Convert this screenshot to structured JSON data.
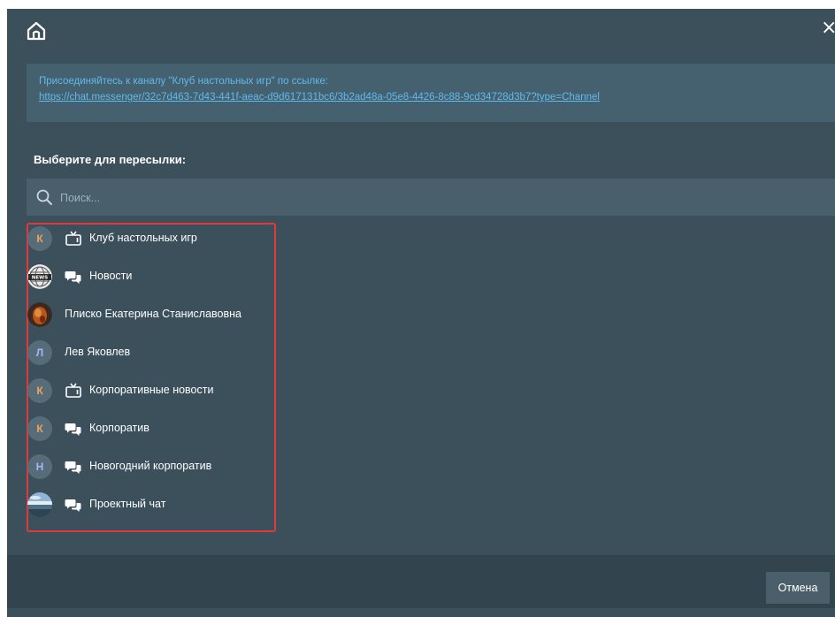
{
  "header": {
    "home_icon": "home-icon",
    "close_label": "×"
  },
  "message": {
    "text": "Присоединяйтесь к каналу \"Клуб настольных игр\" по ссылке:",
    "link": "https://chat.messenger/32c7d463-7d43-441f-aeac-d9d617131bc6/3b2ad48a-05e8-4426-8c88-9cd34728d3b7?type=Channel"
  },
  "forward": {
    "label": "Выберите для пересылки:"
  },
  "search": {
    "placeholder": "Поиск..."
  },
  "contacts": [
    {
      "name": "Клуб настольных игр",
      "avatar": "К",
      "avatar_style": "letter-orange",
      "type": "channel"
    },
    {
      "name": "Новости",
      "avatar": "news-globe",
      "avatar_style": "image",
      "type": "group"
    },
    {
      "name": "Плиско Екатерина Станиславовна",
      "avatar": "photo-dark-orange",
      "avatar_style": "image",
      "type": "person"
    },
    {
      "name": "Лев Яковлев",
      "avatar": "Л",
      "avatar_style": "letter-violet",
      "type": "person"
    },
    {
      "name": "Корпоративные новости",
      "avatar": "К",
      "avatar_style": "letter-orange",
      "type": "channel"
    },
    {
      "name": "Корпоратив",
      "avatar": "К",
      "avatar_style": "letter-orange",
      "type": "group"
    },
    {
      "name": "Новогодний корпоратив",
      "avatar": "Н",
      "avatar_style": "letter-violet",
      "type": "group"
    },
    {
      "name": "Проектный чат",
      "avatar": "landscape-photo",
      "avatar_style": "image",
      "type": "group"
    }
  ],
  "footer": {
    "cancel_label": "Отмена"
  },
  "colors": {
    "background": "#3c505c",
    "link": "#5fb9ec",
    "highlight_border": "#e0393e",
    "avatar_letter_orange": "#f0a35d",
    "avatar_letter_violet": "#a8b4f4"
  }
}
